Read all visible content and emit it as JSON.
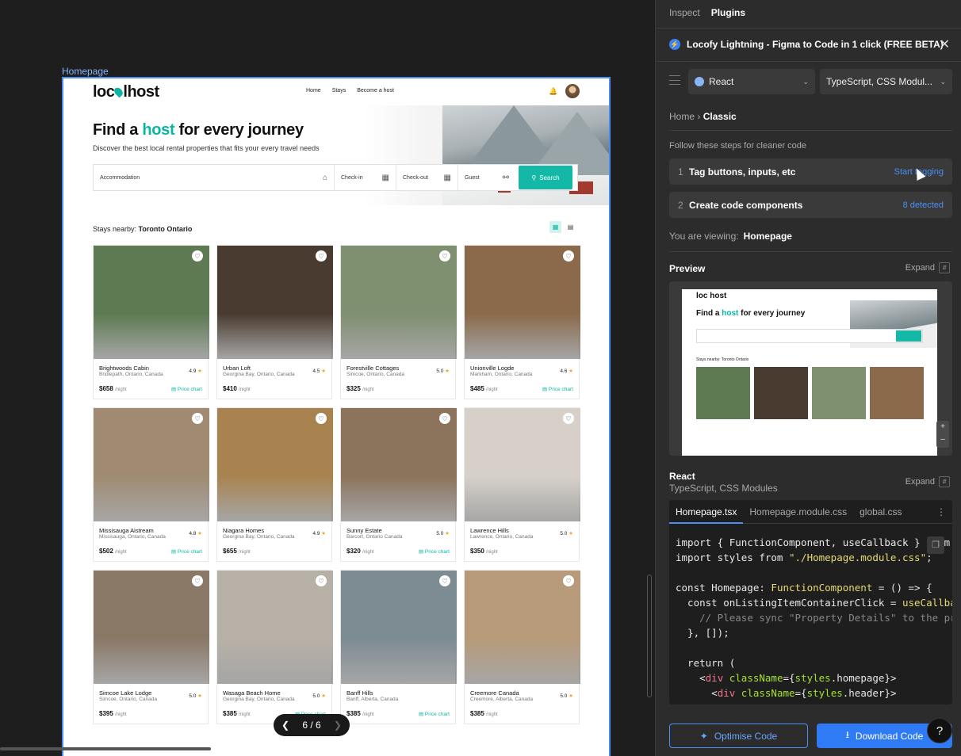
{
  "canvas": {
    "frame_label": "Homepage",
    "pager": {
      "current": "6 / 6"
    }
  },
  "site": {
    "logo": "loc host",
    "nav": [
      "Home",
      "Stays",
      "Become a host"
    ],
    "hero": {
      "title_pre": "Find a ",
      "title_accent": "host",
      "title_post": " for every journey",
      "subtitle": "Discover the best local rental properties that fits your every travel needs"
    },
    "search": {
      "accommodation": "Accommodation",
      "checkin": "Check-in",
      "checkout": "Check-out",
      "guest": "Guest",
      "button": "Search"
    },
    "nearby_label": "Stays nearby: ",
    "nearby_location": "Toronto Ontario",
    "listings": [
      {
        "name": "Brightwoods Cabin",
        "location": "Bridlepath, Ontario, Canada",
        "rating": "4.9",
        "price": "$658",
        "per": "/night",
        "chart": true,
        "img": "#5d7a52"
      },
      {
        "name": "Urban Loft",
        "location": "Georgina Bay, Ontario, Canada",
        "rating": "4.5",
        "price": "$410",
        "per": "/night",
        "chart": false,
        "img": "#4a3b30"
      },
      {
        "name": "Forestville Cottages",
        "location": "Simcoe, Ontario, Canada",
        "rating": "5.0",
        "price": "$325",
        "per": "/night",
        "chart": false,
        "img": "#7f9070"
      },
      {
        "name": "Unionville Logde",
        "location": "Markham, Ontario, Canada",
        "rating": "4.6",
        "price": "$485",
        "per": "/night",
        "chart": true,
        "img": "#8a6a4b"
      },
      {
        "name": "Missisauga Aistream",
        "location": "Missisauga, Ontario, Canada",
        "rating": "4.8",
        "price": "$502",
        "per": "/night",
        "chart": true,
        "img": "#a08b72"
      },
      {
        "name": "Niagara Homes",
        "location": "Georgina Bay, Ontario, Canada",
        "rating": "4.9",
        "price": "$655",
        "per": "/night",
        "chart": false,
        "img": "#a9834f"
      },
      {
        "name": "Sunny Estate",
        "location": "Barcort, Ontario Canada",
        "rating": "5.0",
        "price": "$320",
        "per": "/night",
        "chart": true,
        "img": "#8c735c"
      },
      {
        "name": "Lawrence Hills",
        "location": "Lawrence, Ontario, Canada",
        "rating": "5.0",
        "price": "$350",
        "per": "/night",
        "chart": false,
        "img": "#d6d0c8"
      },
      {
        "name": "Simcoe Lake Lodge",
        "location": "Simcoe, Ontario, Canada",
        "rating": "5.0",
        "price": "$395",
        "per": "/night",
        "chart": false,
        "img": "#8a7866"
      },
      {
        "name": "Wasaga Beach Home",
        "location": "Georgina Bay, Ontario, Canada",
        "rating": "5.0",
        "price": "$385",
        "per": "/night",
        "chart": true,
        "img": "#b7b0a6"
      },
      {
        "name": "Banff Hills",
        "location": "Banff, Alberta, Canada",
        "rating": "",
        "price": "$385",
        "per": "/night",
        "chart": true,
        "img": "#7d8b93"
      },
      {
        "name": "Creemore Canada",
        "location": "Creemore, Alberta, Canada",
        "rating": "5.0",
        "price": "$385",
        "per": "/night",
        "chart": false,
        "img": "#b79a7a"
      }
    ],
    "price_chart_label": "Price chart"
  },
  "panel": {
    "tabs": [
      "Inspect",
      "Plugins"
    ],
    "plugin_title": "Locofy Lightning - Figma to Code in 1 click (FREE BETA)",
    "framework": "React",
    "language": "TypeScript, CSS Modul...",
    "breadcrumb_home": "Home",
    "breadcrumb_current": "Classic",
    "follow_text": "Follow these steps for cleaner code",
    "steps": [
      {
        "num": "1",
        "label": "Tag buttons, inputs, etc",
        "action": "Start tagging"
      },
      {
        "num": "2",
        "label": "Create code components",
        "action": "8 detected"
      }
    ],
    "viewing_label": "You are viewing:",
    "viewing_value": "Homepage",
    "preview_label": "Preview",
    "expand_label": "Expand",
    "preview": {
      "logo": "loc host",
      "title_pre": "Find a ",
      "title_accent": "host",
      "title_post": " for every journey",
      "nearby": "Stays nearby: Toronto Ontario"
    },
    "code_framework": "React",
    "code_sub": "TypeScript, CSS Modules",
    "code_tabs": [
      "Homepage.tsx",
      "Homepage.module.css",
      "global.css"
    ],
    "buttons": {
      "optimise": "Optimise Code",
      "download": "Download Code"
    },
    "help": "?"
  },
  "colors": {
    "accent": "#0bb5a3",
    "panel_bg": "#2c2c2c",
    "primary_blue": "#2f7bf6"
  }
}
